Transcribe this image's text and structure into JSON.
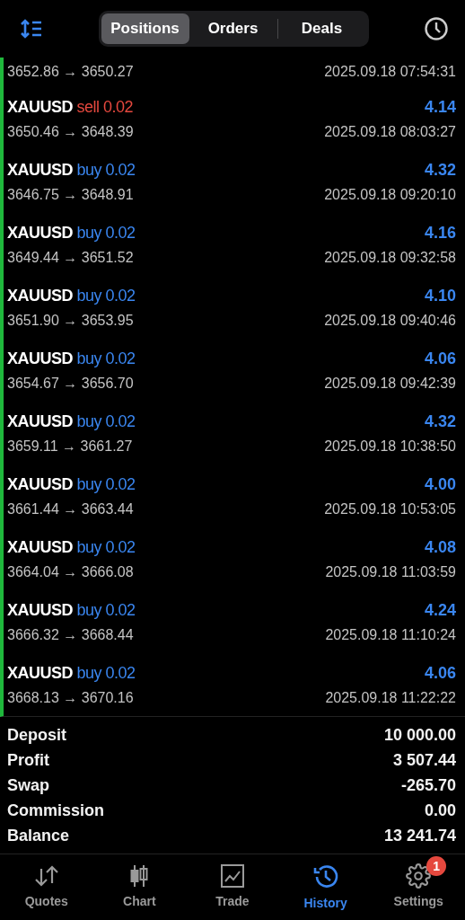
{
  "header": {
    "tabs": [
      {
        "label": "Positions",
        "selected": true
      },
      {
        "label": "Orders",
        "selected": false
      },
      {
        "label": "Deals",
        "selected": false
      }
    ]
  },
  "deals": [
    {
      "prices": "3652.86 → 3650.27",
      "time": "2025.09.18 07:54:31"
    },
    {
      "symbol": "XAUUSD",
      "side": "sell 0.02",
      "color": "#e5483e",
      "profit": "4.14",
      "prices": "3650.46 → 3648.39",
      "time": "2025.09.18 08:03:27"
    },
    {
      "symbol": "XAUUSD",
      "side": "buy 0.02",
      "color": "#3a86f0",
      "profit": "4.32",
      "prices": "3646.75 → 3648.91",
      "time": "2025.09.18 09:20:10"
    },
    {
      "symbol": "XAUUSD",
      "side": "buy 0.02",
      "color": "#3a86f0",
      "profit": "4.16",
      "prices": "3649.44 → 3651.52",
      "time": "2025.09.18 09:32:58"
    },
    {
      "symbol": "XAUUSD",
      "side": "buy 0.02",
      "color": "#3a86f0",
      "profit": "4.10",
      "prices": "3651.90 → 3653.95",
      "time": "2025.09.18 09:40:46"
    },
    {
      "symbol": "XAUUSD",
      "side": "buy 0.02",
      "color": "#3a86f0",
      "profit": "4.06",
      "prices": "3654.67 → 3656.70",
      "time": "2025.09.18 09:42:39"
    },
    {
      "symbol": "XAUUSD",
      "side": "buy 0.02",
      "color": "#3a86f0",
      "profit": "4.32",
      "prices": "3659.11 → 3661.27",
      "time": "2025.09.18 10:38:50"
    },
    {
      "symbol": "XAUUSD",
      "side": "buy 0.02",
      "color": "#3a86f0",
      "profit": "4.00",
      "prices": "3661.44 → 3663.44",
      "time": "2025.09.18 10:53:05"
    },
    {
      "symbol": "XAUUSD",
      "side": "buy 0.02",
      "color": "#3a86f0",
      "profit": "4.08",
      "prices": "3664.04 → 3666.08",
      "time": "2025.09.18 11:03:59"
    },
    {
      "symbol": "XAUUSD",
      "side": "buy 0.02",
      "color": "#3a86f0",
      "profit": "4.24",
      "prices": "3666.32 → 3668.44",
      "time": "2025.09.18 11:10:24"
    },
    {
      "symbol": "XAUUSD",
      "side": "buy 0.02",
      "color": "#3a86f0",
      "profit": "4.06",
      "prices": "3668.13 → 3670.16",
      "time": "2025.09.18 11:22:22"
    }
  ],
  "summary": [
    {
      "label": "Deposit",
      "value": "10 000.00"
    },
    {
      "label": "Profit",
      "value": "3 507.44"
    },
    {
      "label": "Swap",
      "value": "-265.70"
    },
    {
      "label": "Commission",
      "value": "0.00"
    },
    {
      "label": "Balance",
      "value": "13 241.74"
    }
  ],
  "tab_bar": [
    {
      "kind": "quotes",
      "label": "Quotes",
      "selected": false
    },
    {
      "kind": "chart",
      "label": "Chart",
      "selected": false
    },
    {
      "kind": "trade",
      "label": "Trade",
      "selected": false
    },
    {
      "kind": "history",
      "label": "History",
      "selected": true
    },
    {
      "kind": "settings",
      "label": "Settings",
      "selected": false,
      "badge": "1"
    }
  ]
}
